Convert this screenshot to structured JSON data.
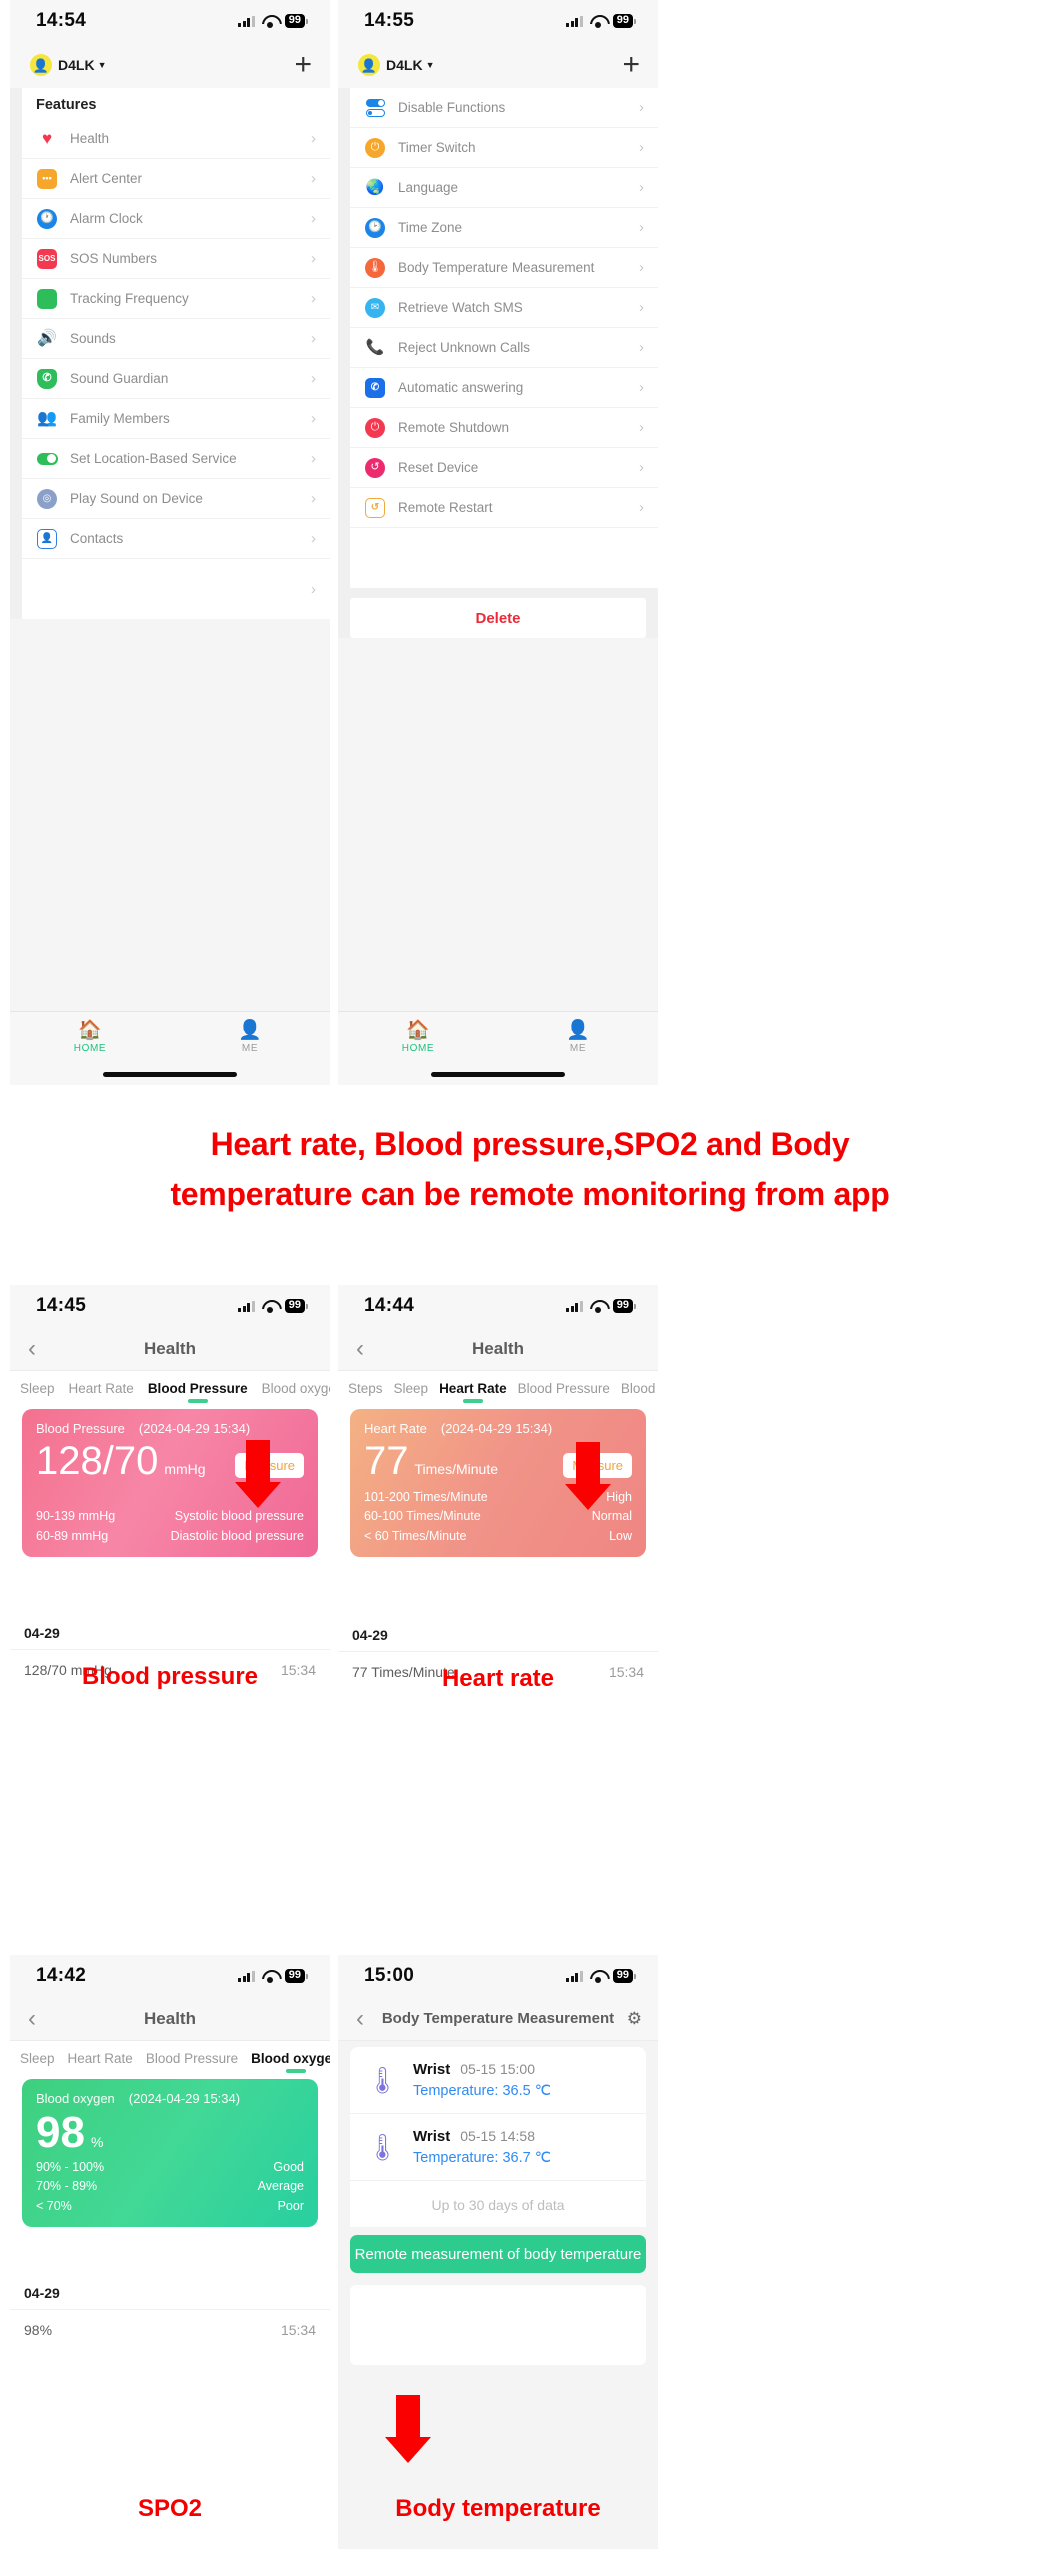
{
  "screen1": {
    "status": {
      "time": "14:54",
      "battery": "99"
    },
    "account": {
      "name": "D4LK",
      "avatar_icon": "person-avatar-icon",
      "caret": "▼"
    },
    "add_button": "+",
    "section_title": "Features",
    "items": [
      {
        "label": "Health",
        "icon": "heart-icon",
        "color": "#f4384f"
      },
      {
        "label": "Alert Center",
        "icon": "alert-message-icon",
        "color": "#f6a62a"
      },
      {
        "label": "Alarm Clock",
        "icon": "alarm-clock-icon",
        "color": "#1b84e8"
      },
      {
        "label": "SOS Numbers",
        "icon": "sos-icon",
        "color": "#f4384f"
      },
      {
        "label": "Tracking Frequency",
        "icon": "layers-icon",
        "color": "#2dbd5a"
      },
      {
        "label": "Sounds",
        "icon": "speaker-icon",
        "color": "#f58150"
      },
      {
        "label": "Sound Guardian",
        "icon": "shield-phone-icon",
        "color": "#2dbd5a"
      },
      {
        "label": "Family Members",
        "icon": "family-icon",
        "color": "#2dbd5a"
      },
      {
        "label": "Set Location-Based Service",
        "icon": "toggle-icon",
        "color": "#2dbd5a"
      },
      {
        "label": "Play Sound on Device",
        "icon": "sound-wave-icon",
        "color": "#8aa0c9"
      },
      {
        "label": "Contacts",
        "icon": "contacts-icon",
        "color": "#2f7fe0"
      },
      {
        "label": "",
        "icon": "",
        "color": ""
      }
    ],
    "tabs": [
      {
        "label": "HOME",
        "icon": "home-icon",
        "active": true
      },
      {
        "label": "ME",
        "icon": "person-icon",
        "active": false
      }
    ]
  },
  "screen2": {
    "status": {
      "time": "14:55",
      "battery": "99"
    },
    "account": {
      "name": "D4LK",
      "avatar_icon": "person-avatar-icon",
      "caret": "▼"
    },
    "add_button": "+",
    "items": [
      {
        "label": "Disable Functions",
        "icon": "toggles-icon",
        "color": "#1b84e8"
      },
      {
        "label": "Timer Switch",
        "icon": "timer-power-icon",
        "color": "#f6a62a"
      },
      {
        "label": "Language",
        "icon": "globe-icon",
        "color": "#f6a62a"
      },
      {
        "label": "Time Zone",
        "icon": "clock-icon",
        "color": "#1b84e8"
      },
      {
        "label": "Body Temperature Measurement",
        "icon": "thermometer-icon",
        "color": "#f4683c"
      },
      {
        "label": "Retrieve Watch SMS",
        "icon": "sms-icon",
        "color": "#35b4ef"
      },
      {
        "label": "Reject Unknown Calls",
        "icon": "call-reject-icon",
        "color": "#f4384f"
      },
      {
        "label": "Automatic answering",
        "icon": "auto-answer-icon",
        "color": "#1b6fe8"
      },
      {
        "label": "Remote Shutdown",
        "icon": "power-icon",
        "color": "#f4384f"
      },
      {
        "label": "Reset Device",
        "icon": "reset-icon",
        "color": "#ee2a6f"
      },
      {
        "label": "Remote Restart",
        "icon": "watch-restart-icon",
        "color": "#f0a93a"
      }
    ],
    "delete_label": "Delete",
    "tabs": [
      {
        "label": "HOME",
        "icon": "home-icon",
        "active": true
      },
      {
        "label": "ME",
        "icon": "person-icon",
        "active": false
      }
    ]
  },
  "headline": {
    "line1": "Heart rate, Blood pressure,SPO2 and Body",
    "line2": "temperature can be remote monitoring from app"
  },
  "screen3": {
    "status": {
      "time": "14:45",
      "battery": "99"
    },
    "nav": {
      "title": "Health",
      "back": "‹"
    },
    "tabs": [
      "Sleep",
      "Heart Rate",
      "Blood Pressure",
      "Blood oxygen"
    ],
    "selected_tab": "Blood Pressure",
    "card": {
      "title": "Blood Pressure",
      "timestamp": "(2024-04-29 15:34)",
      "value": "128/70",
      "unit": "mmHg",
      "measure_label": "Measure",
      "ranges": [
        {
          "range": "90-139 mmHg",
          "level": "Systolic blood pressure"
        },
        {
          "range": "60-89 mmHg",
          "level": "Diastolic blood pressure"
        }
      ]
    },
    "caption": "Blood pressure",
    "day": "04-29",
    "history": [
      {
        "value": "128/70 mmHg",
        "time": "15:34"
      }
    ]
  },
  "screen4": {
    "status": {
      "time": "14:44",
      "battery": "99"
    },
    "nav": {
      "title": "Health",
      "back": "‹"
    },
    "tabs": [
      "Steps",
      "Sleep",
      "Heart Rate",
      "Blood Pressure",
      "Blood o"
    ],
    "selected_tab": "Heart Rate",
    "card": {
      "title": "Heart Rate",
      "timestamp": "(2024-04-29 15:34)",
      "value": "77",
      "unit": "Times/Minute",
      "measure_label": "Measure",
      "ranges": [
        {
          "range": "101-200 Times/Minute",
          "level": "High"
        },
        {
          "range": "60-100 Times/Minute",
          "level": "Normal"
        },
        {
          "range": "< 60 Times/Minute",
          "level": "Low"
        }
      ]
    },
    "caption": "Heart rate",
    "day": "04-29",
    "history": [
      {
        "value": "77 Times/Minute",
        "time": "15:34"
      }
    ]
  },
  "screen5": {
    "status": {
      "time": "14:42",
      "battery": "99"
    },
    "nav": {
      "title": "Health",
      "back": "‹"
    },
    "tabs": [
      "Sleep",
      "Heart Rate",
      "Blood Pressure",
      "Blood oxygen"
    ],
    "selected_tab": "Blood oxygen",
    "card": {
      "title": "Blood oxygen",
      "timestamp": "(2024-04-29 15:34)",
      "value": "98",
      "unit": "%",
      "ranges": [
        {
          "range": "90% - 100%",
          "level": "Good"
        },
        {
          "range": "70% - 89%",
          "level": "Average"
        },
        {
          "range": "< 70%",
          "level": "Poor"
        }
      ]
    },
    "caption": "SPO2",
    "day": "04-29",
    "history": [
      {
        "value": "98%",
        "time": "15:34"
      }
    ]
  },
  "screen6": {
    "status": {
      "time": "15:00",
      "battery": "99"
    },
    "nav": {
      "title": "Body Temperature Measurement",
      "back": "‹",
      "gear_icon": "gear-icon"
    },
    "records": [
      {
        "source": "Wrist",
        "datetime": "05-15 15:00",
        "temperature": "Temperature: 36.5 ℃"
      },
      {
        "source": "Wrist",
        "datetime": "05-15 14:58",
        "temperature": "Temperature: 36.7 ℃"
      }
    ],
    "note": "Up to 30 days of data",
    "button_label": "Remote measurement of body temperature",
    "caption": "Body temperature"
  },
  "colors": {
    "accent_green": "#2ecb8f",
    "red": "#f40000",
    "measure_orange": "#f2a33c"
  }
}
